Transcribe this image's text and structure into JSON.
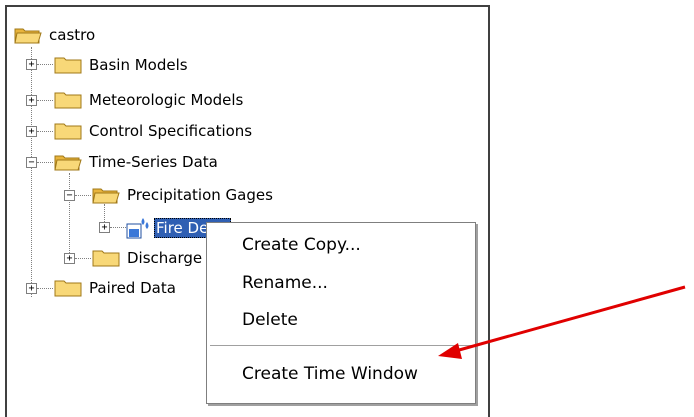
{
  "tree": {
    "root": "castro",
    "items": [
      {
        "label": "Basin Models"
      },
      {
        "label": "Meteorologic Models"
      },
      {
        "label": "Control Specifications"
      },
      {
        "label": "Time-Series Data"
      },
      {
        "label": "Precipitation Gages"
      },
      {
        "label": "Fire Dept."
      },
      {
        "label": "Discharge Gages"
      },
      {
        "label": "Paired Data"
      }
    ]
  },
  "context_menu": {
    "items": [
      "Create Copy...",
      "Rename...",
      "Delete",
      "Create Time Window"
    ]
  },
  "colors": {
    "arrow": "#e00000",
    "selection": "#2f5fb3"
  }
}
